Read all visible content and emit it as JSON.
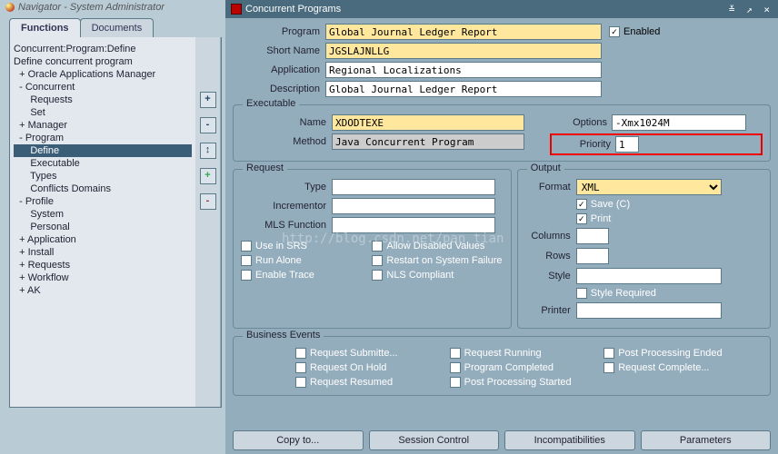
{
  "nav_title": "Navigator - System Administrator",
  "tabs": {
    "functions": "Functions",
    "documents": "Documents"
  },
  "tree_header1": "Concurrent:Program:Define",
  "tree_header2": "Define concurrent program",
  "tree": {
    "items": [
      {
        "pfx": "  + ",
        "label": "Oracle Applications Manager"
      },
      {
        "pfx": "  - ",
        "label": "Concurrent"
      },
      {
        "pfx": "      ",
        "label": "Requests"
      },
      {
        "pfx": "      ",
        "label": "Set"
      },
      {
        "pfx": "  + ",
        "label": "Manager"
      },
      {
        "pfx": "  - ",
        "label": "Program"
      },
      {
        "pfx": "      ",
        "label": "Define",
        "sel": true
      },
      {
        "pfx": "      ",
        "label": "Executable"
      },
      {
        "pfx": "      ",
        "label": "Types"
      },
      {
        "pfx": "      ",
        "label": "Conflicts Domains"
      },
      {
        "pfx": "  - ",
        "label": "Profile"
      },
      {
        "pfx": "      ",
        "label": "System"
      },
      {
        "pfx": "      ",
        "label": "Personal"
      },
      {
        "pfx": "  + ",
        "label": "Application"
      },
      {
        "pfx": "  + ",
        "label": "Install"
      },
      {
        "pfx": "  + ",
        "label": "Requests"
      },
      {
        "pfx": "  + ",
        "label": "Workflow"
      },
      {
        "pfx": "  + ",
        "label": "AK"
      }
    ]
  },
  "side_btns": [
    "+",
    "-",
    "↕",
    "+",
    "-"
  ],
  "win_title": "Concurrent Programs",
  "labels": {
    "program": "Program",
    "short_name": "Short Name",
    "application": "Application",
    "description": "Description",
    "enabled": "Enabled",
    "executable": "Executable",
    "name": "Name",
    "method": "Method",
    "options": "Options",
    "priority": "Priority",
    "request": "Request",
    "type": "Type",
    "incrementor": "Incrementor",
    "mls": "MLS Function",
    "output": "Output",
    "format": "Format",
    "save": "Save (C)",
    "print": "Print",
    "columns": "Columns",
    "rows": "Rows",
    "style": "Style",
    "style_req": "Style Required",
    "printer": "Printer",
    "use_srs": "Use in SRS",
    "run_alone": "Run Alone",
    "enable_trace": "Enable Trace",
    "allow_disabled": "Allow Disabled Values",
    "restart": "Restart on System Failure",
    "nls": "NLS Compliant",
    "biz_events": "Business Events",
    "req_sub": "Request Submitte...",
    "req_running": "Request Running",
    "post_end": "Post Processing Ended",
    "req_hold": "Request On Hold",
    "prog_comp": "Program Completed",
    "req_comp": "Request Complete...",
    "req_resumed": "Request Resumed",
    "post_start": "Post Processing Started"
  },
  "values": {
    "program": "Global Journal Ledger Report",
    "short_name": "JGSLAJNLLG",
    "application": "Regional Localizations",
    "description": "Global Journal Ledger Report",
    "exec_name": "XDODTEXE",
    "method": "Java Concurrent Program",
    "options": "-Xmx1024M",
    "priority": "1",
    "format": "XML",
    "type": "",
    "incrementor": "",
    "mls": "",
    "columns": "",
    "rows": "",
    "style": "",
    "printer": ""
  },
  "checks": {
    "enabled": true,
    "save": true,
    "print": true,
    "style_req": false,
    "use_srs": true,
    "run_alone": false,
    "enable_trace": false,
    "allow_disabled": false,
    "restart": true,
    "nls": true,
    "biz": {
      "req_sub": false,
      "req_running": false,
      "post_end": false,
      "req_hold": false,
      "prog_comp": false,
      "req_comp": false,
      "req_resumed": false,
      "post_start": false
    }
  },
  "buttons": {
    "copy": "Copy to...",
    "session": "Session Control",
    "incomp": "Incompatibilities",
    "params": "Parameters"
  },
  "watermark": "http://blog.csdn.net/pan_tian"
}
